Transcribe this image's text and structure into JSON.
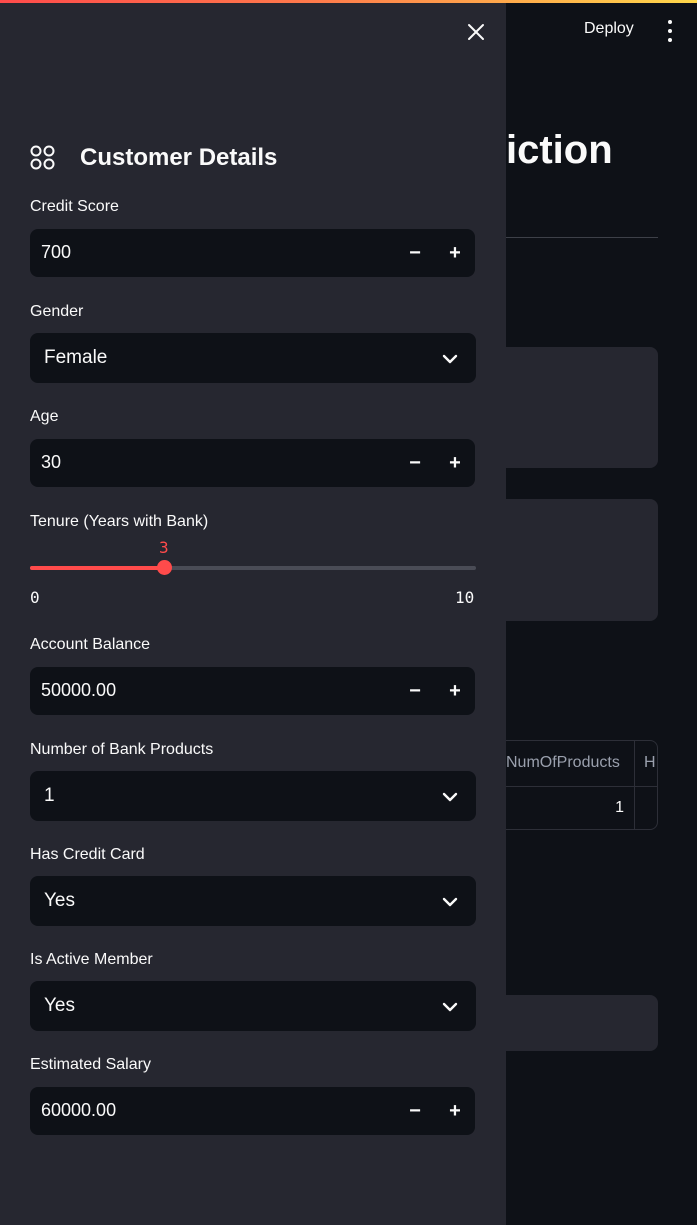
{
  "header": {
    "deploy_label": "Deploy",
    "menu_icon": "kebab-menu-icon"
  },
  "main": {
    "title_visible": "iction",
    "table": {
      "columns": [
        "NumOfProducts",
        "H"
      ],
      "row": [
        "1"
      ]
    }
  },
  "sidebar": {
    "close_icon": "close-icon",
    "heading_icon": "grid-circles-icon",
    "heading": "Customer Details",
    "credit_score": {
      "label": "Credit Score",
      "value": "700"
    },
    "gender": {
      "label": "Gender",
      "value": "Female"
    },
    "age": {
      "label": "Age",
      "value": "30"
    },
    "tenure": {
      "label": "Tenure (Years with Bank)",
      "value": 3,
      "value_label": "3",
      "min": 0,
      "max": 10,
      "min_label": "0",
      "max_label": "10"
    },
    "balance": {
      "label": "Account Balance",
      "value": "50000.00"
    },
    "products": {
      "label": "Number of Bank Products",
      "value": "1"
    },
    "credit_card": {
      "label": "Has Credit Card",
      "value": "Yes"
    },
    "active": {
      "label": "Is Active Member",
      "value": "Yes"
    },
    "salary": {
      "label": "Estimated Salary",
      "value": "60000.00"
    },
    "minus_symbol": "−",
    "plus_symbol": "+"
  },
  "colors": {
    "accent": "#ff4b4b",
    "sidebar_bg": "#262730",
    "input_bg": "#0e1117"
  }
}
